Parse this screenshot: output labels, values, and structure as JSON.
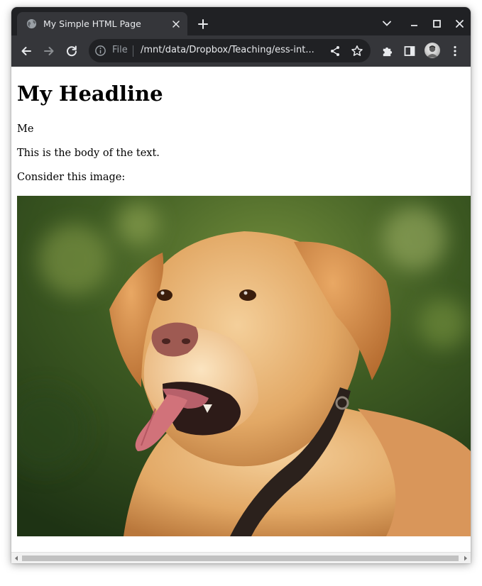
{
  "browser": {
    "tab": {
      "title": "My Simple HTML Page"
    },
    "omnibox": {
      "scheme_label": "File",
      "url": "/mnt/data/Dropbox/Teaching/ess-int..."
    },
    "icons": {
      "tab_favicon": "globe-icon",
      "tab_close": "close-icon",
      "new_tab": "plus-icon",
      "tab_search": "chevron-down-icon",
      "minimize": "minimize-icon",
      "maximize": "maximize-icon",
      "close_window": "close-icon",
      "back": "arrow-left-icon",
      "forward": "arrow-right-icon",
      "reload": "reload-icon",
      "site_info": "info-icon",
      "share": "share-icon",
      "bookmark": "star-icon",
      "extensions": "puzzle-icon",
      "side_panel": "side-panel-icon",
      "profile": "avatar",
      "menu": "kebab-menu-icon"
    },
    "colors": {
      "tabstrip": "#202124",
      "toolbar": "#35363a",
      "omnibox": "#202124",
      "text_light": "#e8eaed",
      "text_dim": "#9aa0a6"
    }
  },
  "page": {
    "headline": "My Headline",
    "author": "Me",
    "body_text": "This is the body of the text.",
    "image_intro": "Consider this image:",
    "image": {
      "subject": "golden retriever dog with collar against green bokeh background"
    }
  }
}
